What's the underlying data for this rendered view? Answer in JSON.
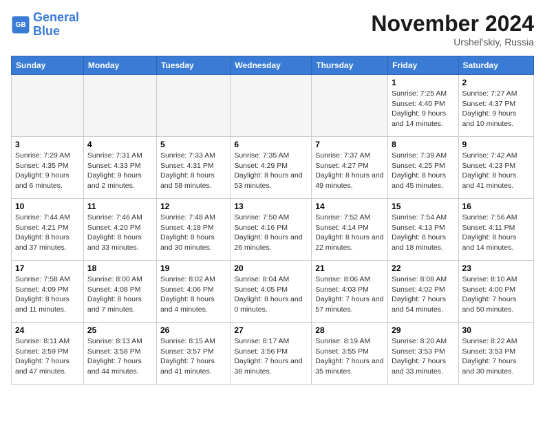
{
  "header": {
    "logo_line1": "General",
    "logo_line2": "Blue",
    "month": "November 2024",
    "location": "Urshel'skiy, Russia"
  },
  "weekdays": [
    "Sunday",
    "Monday",
    "Tuesday",
    "Wednesday",
    "Thursday",
    "Friday",
    "Saturday"
  ],
  "weeks": [
    [
      {
        "day": "",
        "info": ""
      },
      {
        "day": "",
        "info": ""
      },
      {
        "day": "",
        "info": ""
      },
      {
        "day": "",
        "info": ""
      },
      {
        "day": "",
        "info": ""
      },
      {
        "day": "1",
        "info": "Sunrise: 7:25 AM\nSunset: 4:40 PM\nDaylight: 9 hours and 14 minutes."
      },
      {
        "day": "2",
        "info": "Sunrise: 7:27 AM\nSunset: 4:37 PM\nDaylight: 9 hours and 10 minutes."
      }
    ],
    [
      {
        "day": "3",
        "info": "Sunrise: 7:29 AM\nSunset: 4:35 PM\nDaylight: 9 hours and 6 minutes."
      },
      {
        "day": "4",
        "info": "Sunrise: 7:31 AM\nSunset: 4:33 PM\nDaylight: 9 hours and 2 minutes."
      },
      {
        "day": "5",
        "info": "Sunrise: 7:33 AM\nSunset: 4:31 PM\nDaylight: 8 hours and 58 minutes."
      },
      {
        "day": "6",
        "info": "Sunrise: 7:35 AM\nSunset: 4:29 PM\nDaylight: 8 hours and 53 minutes."
      },
      {
        "day": "7",
        "info": "Sunrise: 7:37 AM\nSunset: 4:27 PM\nDaylight: 8 hours and 49 minutes."
      },
      {
        "day": "8",
        "info": "Sunrise: 7:39 AM\nSunset: 4:25 PM\nDaylight: 8 hours and 45 minutes."
      },
      {
        "day": "9",
        "info": "Sunrise: 7:42 AM\nSunset: 4:23 PM\nDaylight: 8 hours and 41 minutes."
      }
    ],
    [
      {
        "day": "10",
        "info": "Sunrise: 7:44 AM\nSunset: 4:21 PM\nDaylight: 8 hours and 37 minutes."
      },
      {
        "day": "11",
        "info": "Sunrise: 7:46 AM\nSunset: 4:20 PM\nDaylight: 8 hours and 33 minutes."
      },
      {
        "day": "12",
        "info": "Sunrise: 7:48 AM\nSunset: 4:18 PM\nDaylight: 8 hours and 30 minutes."
      },
      {
        "day": "13",
        "info": "Sunrise: 7:50 AM\nSunset: 4:16 PM\nDaylight: 8 hours and 26 minutes."
      },
      {
        "day": "14",
        "info": "Sunrise: 7:52 AM\nSunset: 4:14 PM\nDaylight: 8 hours and 22 minutes."
      },
      {
        "day": "15",
        "info": "Sunrise: 7:54 AM\nSunset: 4:13 PM\nDaylight: 8 hours and 18 minutes."
      },
      {
        "day": "16",
        "info": "Sunrise: 7:56 AM\nSunset: 4:11 PM\nDaylight: 8 hours and 14 minutes."
      }
    ],
    [
      {
        "day": "17",
        "info": "Sunrise: 7:58 AM\nSunset: 4:09 PM\nDaylight: 8 hours and 11 minutes."
      },
      {
        "day": "18",
        "info": "Sunrise: 8:00 AM\nSunset: 4:08 PM\nDaylight: 8 hours and 7 minutes."
      },
      {
        "day": "19",
        "info": "Sunrise: 8:02 AM\nSunset: 4:06 PM\nDaylight: 8 hours and 4 minutes."
      },
      {
        "day": "20",
        "info": "Sunrise: 8:04 AM\nSunset: 4:05 PM\nDaylight: 8 hours and 0 minutes."
      },
      {
        "day": "21",
        "info": "Sunrise: 8:06 AM\nSunset: 4:03 PM\nDaylight: 7 hours and 57 minutes."
      },
      {
        "day": "22",
        "info": "Sunrise: 8:08 AM\nSunset: 4:02 PM\nDaylight: 7 hours and 54 minutes."
      },
      {
        "day": "23",
        "info": "Sunrise: 8:10 AM\nSunset: 4:00 PM\nDaylight: 7 hours and 50 minutes."
      }
    ],
    [
      {
        "day": "24",
        "info": "Sunrise: 8:11 AM\nSunset: 3:59 PM\nDaylight: 7 hours and 47 minutes."
      },
      {
        "day": "25",
        "info": "Sunrise: 8:13 AM\nSunset: 3:58 PM\nDaylight: 7 hours and 44 minutes."
      },
      {
        "day": "26",
        "info": "Sunrise: 8:15 AM\nSunset: 3:57 PM\nDaylight: 7 hours and 41 minutes."
      },
      {
        "day": "27",
        "info": "Sunrise: 8:17 AM\nSunset: 3:56 PM\nDaylight: 7 hours and 38 minutes."
      },
      {
        "day": "28",
        "info": "Sunrise: 8:19 AM\nSunset: 3:55 PM\nDaylight: 7 hours and 35 minutes."
      },
      {
        "day": "29",
        "info": "Sunrise: 8:20 AM\nSunset: 3:53 PM\nDaylight: 7 hours and 33 minutes."
      },
      {
        "day": "30",
        "info": "Sunrise: 8:22 AM\nSunset: 3:53 PM\nDaylight: 7 hours and 30 minutes."
      }
    ]
  ]
}
